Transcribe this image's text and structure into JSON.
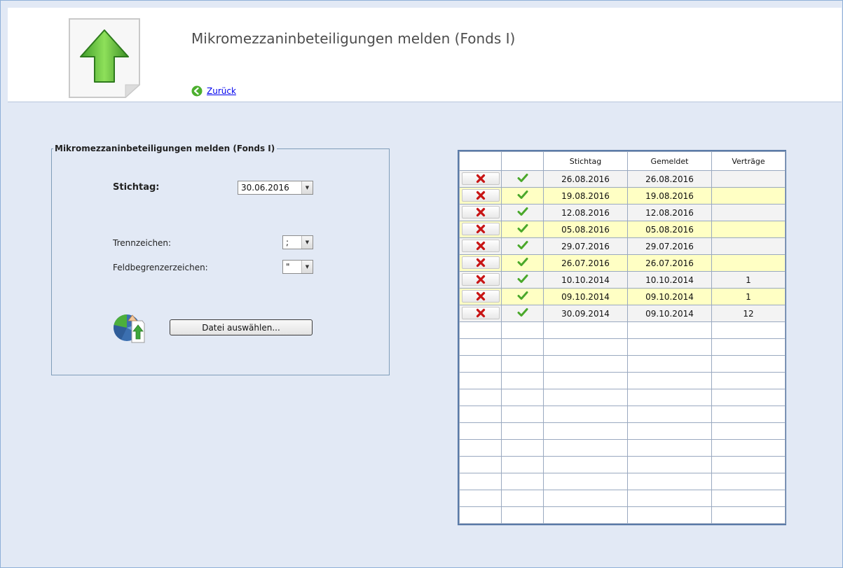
{
  "header": {
    "title": "Mikromezzaninbeteiligungen melden (Fonds I)",
    "back_label": "Zurück"
  },
  "form": {
    "legend": "Mikromezzaninbeteiligungen melden (Fonds I)",
    "stichtag_label": "Stichtag:",
    "stichtag_value": "30.06.2016",
    "trennzeichen_label": "Trennzeichen:",
    "trennzeichen_value": ";",
    "feldbegrenzer_label": "Feldbegrenzerzeichen:",
    "feldbegrenzer_value": "\"",
    "file_button_label": "Datei auswählen..."
  },
  "table": {
    "columns": [
      "",
      "",
      "Stichtag",
      "Gemeldet",
      "Verträge"
    ],
    "rows": [
      {
        "stichtag": "26.08.2016",
        "gemeldet": "26.08.2016",
        "vertraege": ""
      },
      {
        "stichtag": "19.08.2016",
        "gemeldet": "19.08.2016",
        "vertraege": ""
      },
      {
        "stichtag": "12.08.2016",
        "gemeldet": "12.08.2016",
        "vertraege": ""
      },
      {
        "stichtag": "05.08.2016",
        "gemeldet": "05.08.2016",
        "vertraege": ""
      },
      {
        "stichtag": "29.07.2016",
        "gemeldet": "29.07.2016",
        "vertraege": ""
      },
      {
        "stichtag": "26.07.2016",
        "gemeldet": "26.07.2016",
        "vertraege": ""
      },
      {
        "stichtag": "10.10.2014",
        "gemeldet": "10.10.2014",
        "vertraege": "1"
      },
      {
        "stichtag": "09.10.2014",
        "gemeldet": "09.10.2014",
        "vertraege": "1"
      },
      {
        "stichtag": "30.09.2014",
        "gemeldet": "09.10.2014",
        "vertraege": "12"
      }
    ]
  },
  "icons": {
    "page": "upload-arrow-icon",
    "back": "back-arrow-icon",
    "file": "file-upload-icon",
    "delete": "delete-x-icon",
    "ok": "checkmark-icon"
  },
  "colors": {
    "background": "#e2e9f5",
    "alt_row": "#ffffc4",
    "delete_red": "#cc1111",
    "check_green": "#4aa82a"
  }
}
